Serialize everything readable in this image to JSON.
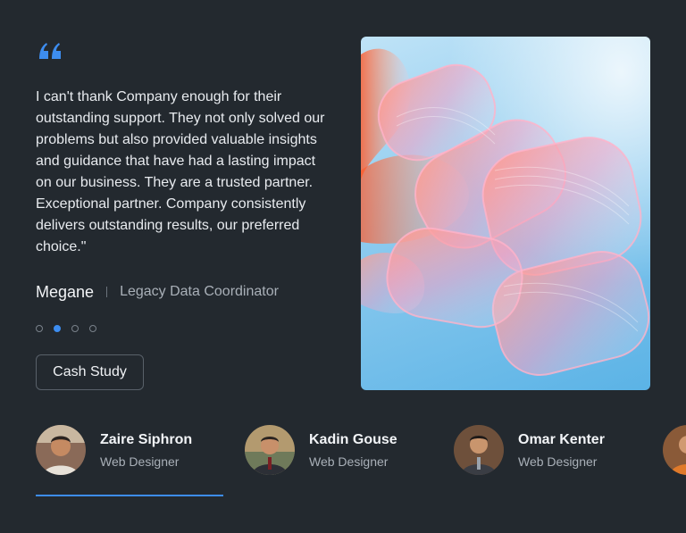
{
  "testimonial": {
    "quote": "I can't thank Company enough for their outstanding support. They not only solved our problems but also provided valuable insights and guidance that have had a lasting impact on our business. They are a trusted partner. Exceptional partner. Company consistently delivers outstanding results, our preferred choice.\"",
    "author_name": "Megane",
    "author_role": "Legacy Data Coordinator",
    "active_index": 1,
    "total_slides": 4
  },
  "cta": {
    "label": "Cash Study"
  },
  "accent_color": "#3d8df0",
  "icons": {
    "quote": "quote-icon"
  },
  "people": [
    {
      "name": "Zaire Siphron",
      "role": "Web Designer"
    },
    {
      "name": "Kadin Gouse",
      "role": "Web Designer"
    },
    {
      "name": "Omar Kenter",
      "role": "Web Designer"
    }
  ]
}
